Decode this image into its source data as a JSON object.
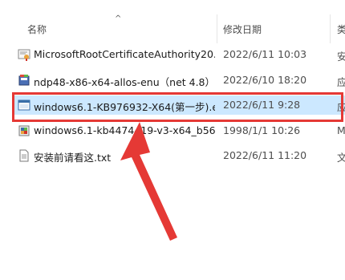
{
  "header": {
    "sort_indicator": "^",
    "col_name": "名称",
    "col_date": "修改日期",
    "col_type": "类"
  },
  "files": [
    {
      "name": "MicrosoftRootCertificateAuthority20...",
      "date": "2022/6/11 10:03",
      "type": "安",
      "icon": "certificate-icon"
    },
    {
      "name": "ndp48-x86-x64-allos-enu（net 4.8）....",
      "date": "2022/6/10 18:20",
      "type": "应",
      "icon": "installer-icon"
    },
    {
      "name": "windows6.1-KB976932-X64(第一步).e...",
      "date": "2022/6/11 9:28",
      "type": "应",
      "icon": "exe-window-icon",
      "selected": true
    },
    {
      "name": "windows6.1-kb4474419-v3-x64_b561...",
      "date": "1998/1/1 10:26",
      "type": "M",
      "icon": "msu-package-icon"
    },
    {
      "name": "安装前请看这.txt",
      "date": "2022/6/11 11:20",
      "type": "文",
      "icon": "text-file-icon"
    }
  ],
  "colors": {
    "selection": "#cce8ff",
    "annotation": "#e53935"
  }
}
